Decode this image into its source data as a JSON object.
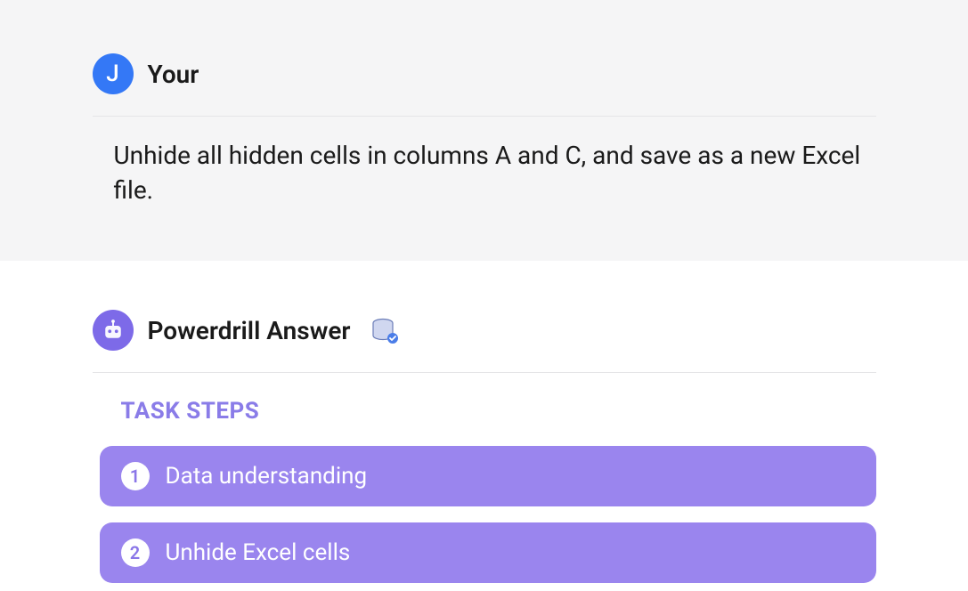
{
  "user": {
    "avatar_initial": "J",
    "name": "Your",
    "message": "Unhide all hidden cells in columns A and C, and save as a new Excel file."
  },
  "answer": {
    "title": "Powerdrill Answer",
    "task_steps_heading": "TASK STEPS",
    "steps": [
      {
        "number": "1",
        "label": "Data understanding"
      },
      {
        "number": "2",
        "label": "Unhide Excel cells"
      }
    ]
  },
  "colors": {
    "user_avatar_bg": "#3478f6",
    "bot_avatar_bg": "#7d6ae8",
    "task_steps_heading": "#8a7ce8",
    "step_bg": "#9a85ee"
  }
}
